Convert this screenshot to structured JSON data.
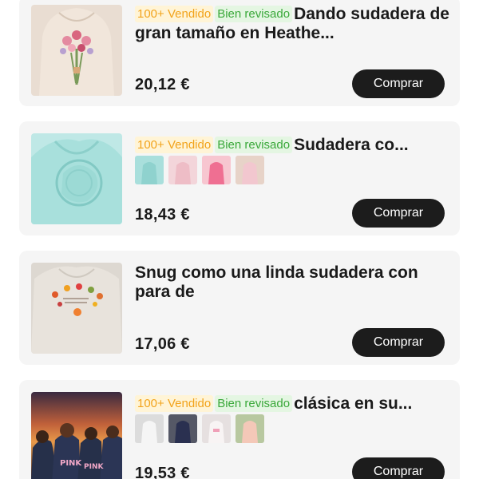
{
  "products": [
    {
      "badges": {
        "sold": "100+ Vendido",
        "review": "Bien revisado"
      },
      "title": "Dando sudadera de gran tamaño en Heathe...",
      "price": "20,12 €",
      "buy_label": "Comprar"
    },
    {
      "badges": {
        "sold": "100+ Vendido",
        "review": "Bien revisado"
      },
      "title": "Sudadera co...",
      "price": "18,43 €",
      "buy_label": "Comprar",
      "swatches": [
        "mint-hoodie-swatch",
        "pale-pink-hoodie-swatch",
        "hot-pink-hoodie-swatch",
        "blush-hoodie-swatch"
      ]
    },
    {
      "title": "Snug como una linda sudadera con para de",
      "price": "17,06 €",
      "buy_label": "Comprar"
    },
    {
      "badges": {
        "sold": "100+ Vendido",
        "review": "Bien revisado"
      },
      "title": "clásica en su...",
      "price": "19,53 €",
      "buy_label": "Comprar",
      "swatches": [
        "white-hoodie-swatch",
        "navy-hoodie-swatch",
        "white-pink-hoodie-swatch",
        "peach-hoodie-swatch"
      ],
      "image_text": "PINK"
    }
  ],
  "colors": {
    "card_bg": "#f5f5f5",
    "button_bg": "#1c1c1c",
    "badge_sold": "#f2a31b",
    "badge_review": "#3aa83a"
  }
}
